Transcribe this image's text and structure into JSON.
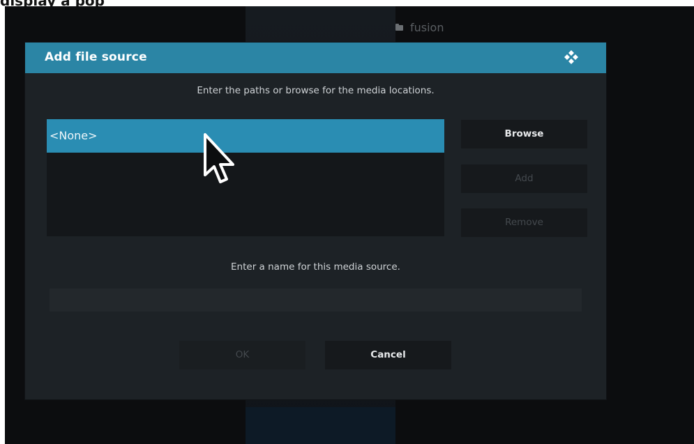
{
  "top_crop_text": "display a pop",
  "background": {
    "folder_label": "fusion",
    "folder_icon": "folder-icon"
  },
  "dialog": {
    "title": "Add file source",
    "header_icon": "kodi-logo-icon",
    "paths_prompt": "Enter the paths or browse for the media locations.",
    "paths": [
      {
        "label": "<None>",
        "selected": true
      }
    ],
    "buttons": {
      "browse": "Browse",
      "add": "Add",
      "remove": "Remove",
      "ok": "OK",
      "cancel": "Cancel"
    },
    "name_prompt": "Enter a name for this media source.",
    "name_value": ""
  },
  "colors": {
    "accent": "#2b85a5",
    "selected_item": "#2a8db3",
    "dialog_bg": "#1d2226",
    "button_bg": "#16191c",
    "disabled_text": "#44494e"
  },
  "pointer": "mouse-pointer-icon"
}
